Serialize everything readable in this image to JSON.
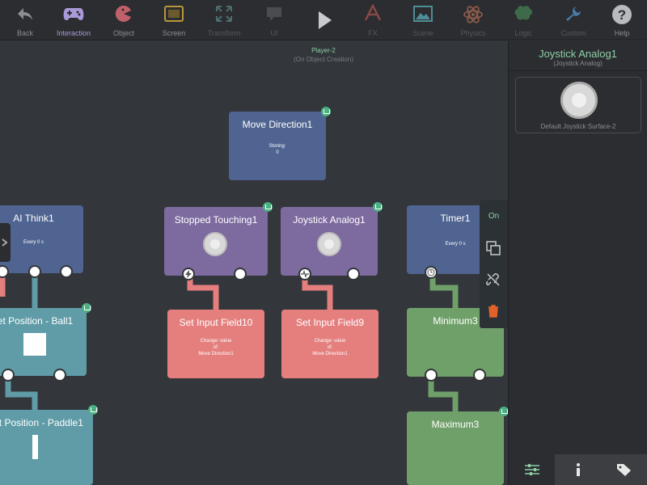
{
  "toolbar": {
    "items": [
      {
        "label": "Back",
        "icon": "back-arrow-icon"
      },
      {
        "label": "Interaction",
        "icon": "gamepad-icon"
      },
      {
        "label": "Object",
        "icon": "pacman-icon"
      },
      {
        "label": "Screen",
        "icon": "screen-icon"
      },
      {
        "label": "Transform",
        "icon": "transform-icon"
      },
      {
        "label": "UI",
        "icon": "speech-bubble-icon"
      },
      {
        "label": "",
        "icon": "play-icon"
      },
      {
        "label": "FX",
        "icon": "fx-icon"
      },
      {
        "label": "Scene",
        "icon": "scene-icon"
      },
      {
        "label": "Physics",
        "icon": "atom-icon"
      },
      {
        "label": "Logic",
        "icon": "brain-icon"
      },
      {
        "label": "Custom",
        "icon": "wrench-icon"
      },
      {
        "label": "Help",
        "icon": "help-icon"
      }
    ]
  },
  "canvas": {
    "player_title": "Player-2",
    "player_sub": "(On Object Creation)",
    "nodes": {
      "move_direction": {
        "title": "Move Direction1",
        "sub1": "Storing:",
        "sub2": "0"
      },
      "ai_think": {
        "title": "AI Think1",
        "sub1": "Every 0 s"
      },
      "stopped_touching": {
        "title": "Stopped Touching1"
      },
      "joystick_analog": {
        "title": "Joystick Analog1"
      },
      "timer": {
        "title": "Timer1",
        "sub1": "Every 0 s"
      },
      "set_position_ball": {
        "title": "et Position - Ball1"
      },
      "set_input_field10": {
        "title": "Set Input Field10",
        "sub1": "Change: value",
        "sub2": "of:",
        "sub3": "Move Direction1"
      },
      "set_input_field9": {
        "title": "Set Input Field9",
        "sub1": "Change: value",
        "sub2": "of:",
        "sub3": "Move Direction1"
      },
      "minimum": {
        "title": "Minimum3"
      },
      "set_position_paddle": {
        "title": "et Position - Paddle1"
      },
      "maximum": {
        "title": "Maximum3"
      }
    }
  },
  "context_menu": {
    "on_label": "On"
  },
  "panel": {
    "title": "Joystick Analog1",
    "subtitle": "(Joystick Analog)",
    "surface_label": "Default Joystick Surface-2"
  },
  "colors": {
    "accent_green": "#8fd0a7",
    "node_blue": "#4f6490",
    "node_purple": "#7d6a9f",
    "node_red": "#e47f7e",
    "node_teal": "#5f9ca7",
    "node_green": "#70a06a",
    "interaction_active": "#a999d8",
    "delete_orange": "#e0622a"
  }
}
